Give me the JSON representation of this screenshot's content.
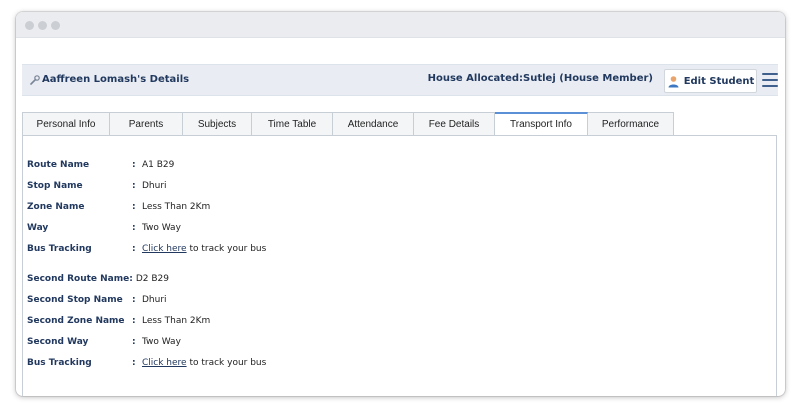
{
  "header": {
    "student_title": "Aaffreen Lomash's Details",
    "house_info": "House Allocated:Sutlej (House Member)",
    "edit_button_label": "Edit Student"
  },
  "tabs": [
    {
      "label": "Personal Info",
      "active": false
    },
    {
      "label": "Parents",
      "active": false
    },
    {
      "label": "Subjects",
      "active": false
    },
    {
      "label": "Time Table",
      "active": false
    },
    {
      "label": "Attendance",
      "active": false
    },
    {
      "label": "Fee Details",
      "active": false
    },
    {
      "label": "Transport Info",
      "active": true
    },
    {
      "label": "Performance",
      "active": false
    }
  ],
  "transport": {
    "route_name": {
      "label": "Route Name",
      "value": "A1 B29"
    },
    "stop_name": {
      "label": "Stop Name",
      "value": "Dhuri"
    },
    "zone_name": {
      "label": "Zone Name",
      "value": "Less Than 2Km"
    },
    "way": {
      "label": "Way",
      "value": "Two Way"
    },
    "bus_tracking": {
      "label": "Bus Tracking",
      "link_text": "Click here",
      "suffix": " to track your bus"
    },
    "second_route_name": {
      "label": "Second Route Name:",
      "value": "D2 B29"
    },
    "second_stop_name": {
      "label": "Second Stop Name",
      "value": "Dhuri"
    },
    "second_zone_name": {
      "label": "Second Zone Name",
      "value": "Less Than 2Km"
    },
    "second_way": {
      "label": "Second Way",
      "value": "Two Way"
    },
    "second_bus_tracking": {
      "label": "Bus Tracking",
      "link_text": "Click here",
      "suffix": " to track your bus"
    }
  },
  "colon": ":",
  "colors": {
    "accent": "#22395f",
    "active_tab": "#5b8fd6"
  }
}
